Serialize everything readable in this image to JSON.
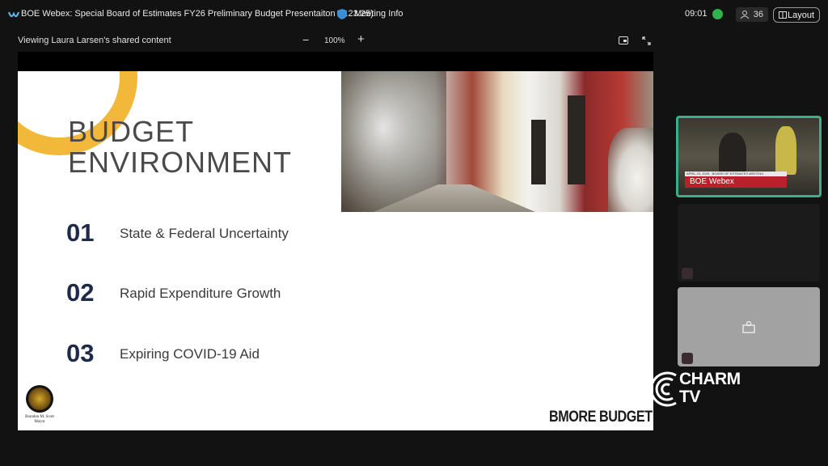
{
  "window": {
    "title": "BOE Webex: Special Board of Estimates FY26 Preliminary Budget Presentaiton (4.23.25)",
    "meeting_info_label": "Meeting Info",
    "clock": "09:01",
    "participant_count": "36",
    "layout_label": "Layout"
  },
  "share_bar": {
    "label": "Viewing Laura Larsen's shared content",
    "zoom_out": "−",
    "zoom_level": "100%",
    "zoom_in": "+"
  },
  "slide": {
    "title_line1": "BUDGET",
    "title_line2": "ENVIRONMENT",
    "items": [
      {
        "number": "01",
        "text": "State & Federal Uncertainty"
      },
      {
        "number": "02",
        "text": "Rapid Expenditure Growth"
      },
      {
        "number": "03",
        "text": "Expiring COVID-19 Aid"
      }
    ],
    "mayor_line1": "Brandon M. Scott",
    "mayor_line2": "Mayor",
    "brand_logo": "BMORE BUDGET"
  },
  "video": {
    "lower_third_top": "APRIL 23, 2025 · BOARD OF ESTIMATES MEETING",
    "name": "BOE Webex"
  },
  "watermark": {
    "line1": "CHARM",
    "line2": "TV"
  },
  "colors": {
    "accent_green": "#3ab08a",
    "slide_gold": "#f2b83a",
    "slide_navy": "#1e2a4a",
    "lower_third_red": "#b8202a"
  }
}
